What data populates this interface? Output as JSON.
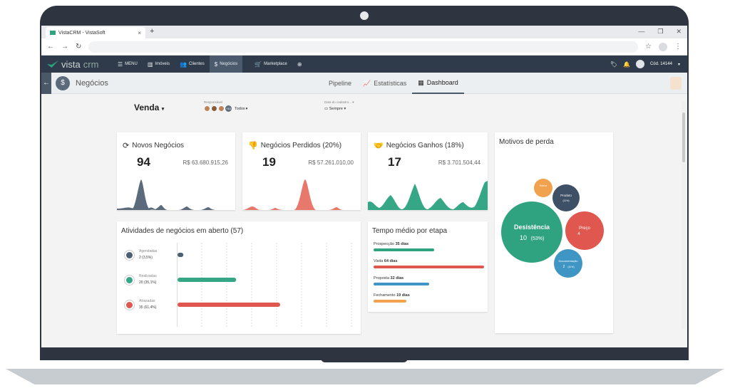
{
  "browser": {
    "tab_title": "VistaCRM - VistaSoft",
    "tab_close": "×",
    "new_tab": "+",
    "window_controls": [
      "—",
      "❐",
      "✕"
    ]
  },
  "appnav": {
    "logo_a": "vista",
    "logo_b": "crm",
    "items": [
      {
        "label": "MENU",
        "icon": "menu-icon"
      },
      {
        "label": "Imóveis",
        "icon": "building-icon"
      },
      {
        "label": "Clientes",
        "icon": "users-icon"
      },
      {
        "label": "Negócios",
        "icon": "dollar-icon"
      },
      {
        "label": "Marketplace",
        "icon": "cart-icon"
      }
    ],
    "user_code": "Cód. 14144"
  },
  "subheader": {
    "title": "Negócios",
    "tabs": [
      "Pipeline",
      "Estatísticas",
      "Dashboard"
    ],
    "active_tab": "Dashboard"
  },
  "filters": {
    "pipeline": "Venda",
    "responsavel_label": "Responsável",
    "responsavel_more": "+10",
    "responsavel_value": "Todos",
    "date_label": "Data do cadastro...",
    "date_value": "Sempre"
  },
  "kpis": [
    {
      "title": "Novos Negócios",
      "count": "94",
      "value": "R$ 63.680.915,26",
      "color": "#5b6b7c"
    },
    {
      "title": "Negócios Perdidos (20%)",
      "count": "19",
      "value": "R$ 57.261.010,00",
      "color": "#e8776c"
    },
    {
      "title": "Negócios Ganhos (18%)",
      "count": "17",
      "value": "R$ 3.701.504,44",
      "color": "#35a786"
    }
  ],
  "activities": {
    "title": "Atividades de negócios em aberto (57)",
    "rows": [
      {
        "label": "Agendadas",
        "value": "2 (3,5%)",
        "pct": 3.5,
        "color": "#4c5f73"
      },
      {
        "label": "Realizadas",
        "value": "20 (35,1%)",
        "pct": 35.1,
        "color": "#35a786"
      },
      {
        "label": "Atrasadas",
        "value": "35 (61,4%)",
        "pct": 61.4,
        "color": "#e0574f"
      }
    ]
  },
  "stages": {
    "title": "Tempo médio por etapa",
    "rows": [
      {
        "name": "Prospecção",
        "days": "35 dias",
        "n": 35,
        "color": "#2fa37f"
      },
      {
        "name": "Visita",
        "days": "64 dias",
        "n": 64,
        "color": "#e0574f"
      },
      {
        "name": "Proposta",
        "days": "32 dias",
        "n": 32,
        "color": "#3f95c3"
      },
      {
        "name": "Fechamento",
        "days": "19 dias",
        "n": 19,
        "color": "#f0a24f"
      }
    ]
  },
  "loss": {
    "title": "Motivos de perda",
    "bubbles": [
      {
        "name": "Desistência",
        "value": "10",
        "pct": "(53%)",
        "color": "#2fa37f"
      },
      {
        "name": "Preço",
        "value": "4",
        "pct": "",
        "color": "#e0574f"
      },
      {
        "name": "Documentação",
        "value": "2",
        "pct": "(11%)",
        "color": "#3f95c3"
      },
      {
        "name": "Produto",
        "value": "",
        "pct": "(11%)",
        "color": "#3d5066"
      },
      {
        "name": "Outros",
        "value": "",
        "pct": "",
        "color": "#f0a24f"
      }
    ]
  },
  "chart_data": {
    "type": "bar",
    "categories": [
      "Agendadas",
      "Realizadas",
      "Atrasadas"
    ],
    "values": [
      2,
      20,
      35
    ],
    "title": "Atividades de negócios em aberto (57)"
  }
}
